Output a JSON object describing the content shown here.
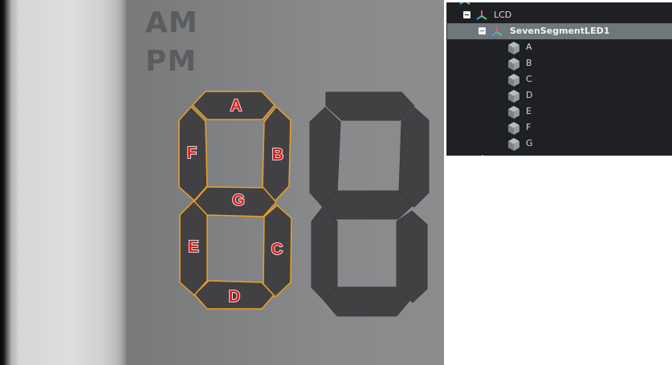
{
  "viewport": {
    "am_label": "AM",
    "pm_label": "PM",
    "segment_labels": {
      "a": "A",
      "b": "B",
      "c": "C",
      "d": "D",
      "e": "E",
      "f": "F",
      "g": "G"
    },
    "colors": {
      "segment_fill": "#414144",
      "selection_outline": "#f0a020",
      "label_color": "#e01c1c"
    }
  },
  "hierarchy": {
    "lcd": {
      "label": "LCD",
      "icon": "transform-axes-icon"
    },
    "seven_segment": {
      "label": "SevenSegmentLED1",
      "icon": "transform-axes-icon",
      "selected": true
    },
    "children": [
      {
        "label": "A",
        "icon": "cube-icon"
      },
      {
        "label": "B",
        "icon": "cube-icon"
      },
      {
        "label": "C",
        "icon": "cube-icon"
      },
      {
        "label": "D",
        "icon": "cube-icon"
      },
      {
        "label": "E",
        "icon": "cube-icon"
      },
      {
        "label": "F",
        "icon": "cube-icon"
      },
      {
        "label": "G",
        "icon": "cube-icon"
      }
    ]
  }
}
